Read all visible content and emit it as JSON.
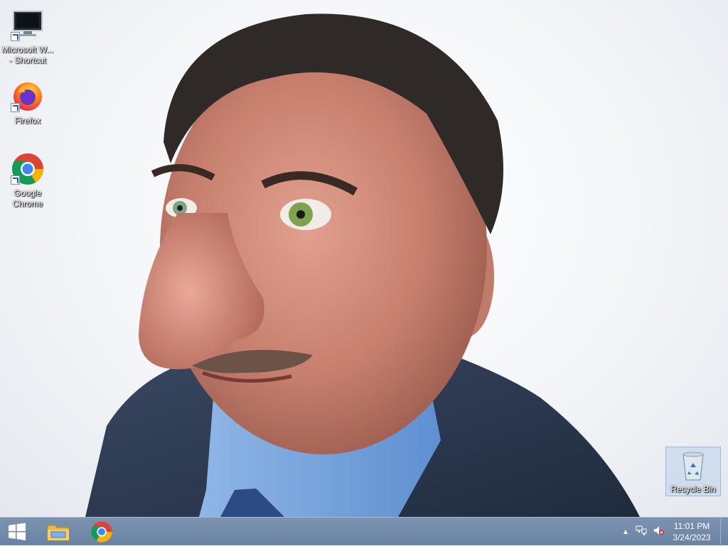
{
  "desktop": {
    "icons": [
      {
        "label": "Microsoft W...\n- Shortcut",
        "icon": "monitor-icon"
      },
      {
        "label": "Firefox",
        "icon": "firefox-icon"
      },
      {
        "label": "Google\nChrome",
        "icon": "chrome-icon"
      }
    ],
    "recycle_bin": {
      "label": "Recycle Bin",
      "icon": "recycle-bin-icon"
    }
  },
  "taskbar": {
    "start": {
      "icon": "windows-logo-icon"
    },
    "pinned": [
      {
        "name": "File Explorer",
        "icon": "folder-icon"
      },
      {
        "name": "Google Chrome",
        "icon": "chrome-icon"
      }
    ],
    "tray": {
      "icons": [
        "chevron-up-icon",
        "network-icon",
        "volume-muted-icon"
      ]
    },
    "clock": {
      "time": "11:01 PM",
      "date": "3/24/2023"
    }
  },
  "colors": {
    "taskbar": "#6f86a6",
    "recycle_highlight": "#c4d6ee"
  }
}
